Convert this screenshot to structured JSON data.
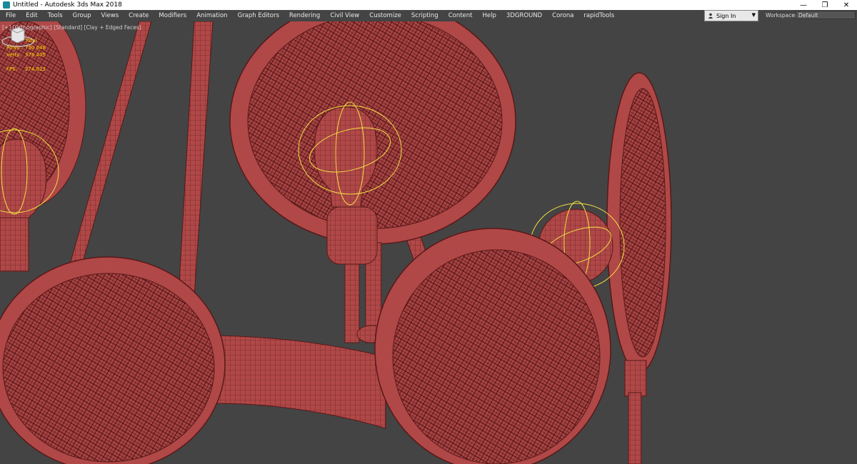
{
  "window": {
    "title": "Untitled - Autodesk 3ds Max 2018",
    "controls": [
      "—",
      "❐",
      "✕"
    ]
  },
  "menu": {
    "items": [
      "File",
      "Edit",
      "Tools",
      "Group",
      "Views",
      "Create",
      "Modifiers",
      "Animation",
      "Graph Editors",
      "Rendering",
      "Civil View",
      "Customize",
      "Scripting",
      "Content",
      "Help",
      "3DGROUND",
      "Corona",
      "rapidTools"
    ]
  },
  "account": {
    "sign_in": "Sign In"
  },
  "workspaces": {
    "label": "Workspaces:",
    "value": "Default"
  },
  "viewport": {
    "label": "[+] [Orthographic] [Standard] [Clay + Edged Faces]",
    "stats": {
      "header": "Total",
      "polys_label": "Polys:",
      "polys_value": "750 648",
      "verts_label": "Verts:",
      "verts_value": "376 405",
      "fps_label": "FPS:",
      "fps_value": "274.823"
    }
  },
  "colors": {
    "viewport_bg": "#444444",
    "clay": "#b04848",
    "wire": "#5a1818",
    "gizmo": "#f0e040",
    "stats_text": "#ffd400"
  },
  "icons": [
    "app-icon",
    "minimize-icon",
    "restore-icon",
    "close-icon",
    "user-icon",
    "dropdown-caret-icon",
    "viewcube-icon"
  ]
}
